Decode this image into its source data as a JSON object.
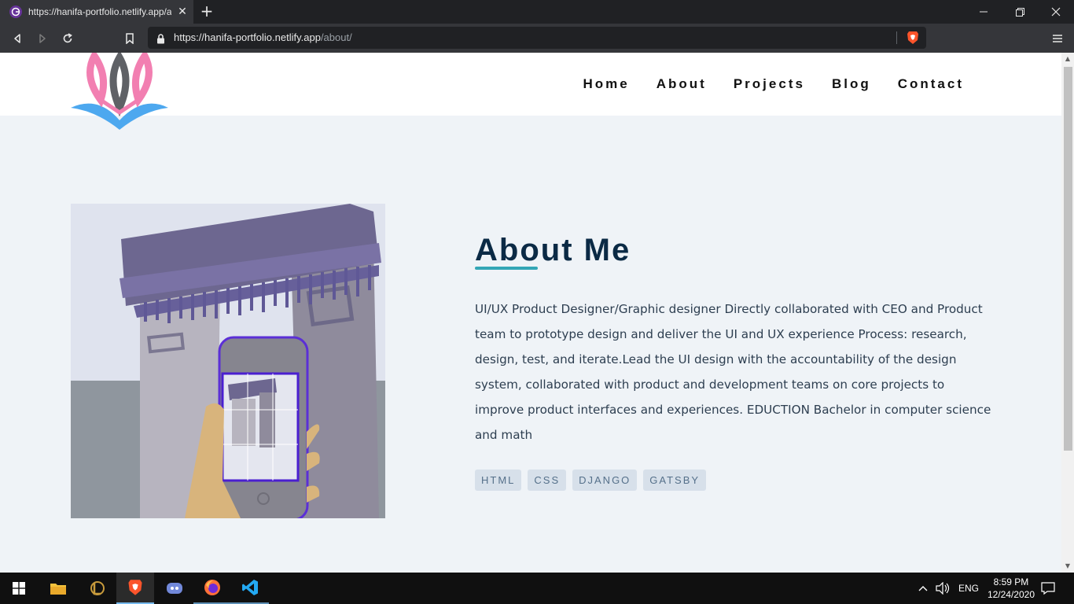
{
  "browser": {
    "tab_title": "https://hanifa-portfolio.netlify.app/about/",
    "url_host": "https://hanifa-portfolio.netlify.app",
    "url_path": "/about/"
  },
  "site": {
    "nav": [
      "Home",
      "About",
      "Projects",
      "Blog",
      "Contact"
    ],
    "about_title": "About Me",
    "about_text": "UI/UX Product Designer/Graphic designer Directly collaborated with CEO and Product team to prototype design and deliver the UI and UX experience Process: research, design, test, and iterate.Lead the UI design with the accountability of the design system, collaborated with product and development teams on core projects to improve product interfaces and experiences. EDUCTION Bachelor in computer science and math",
    "tags": [
      "HTML",
      "CSS",
      "DJANGO",
      "GATSBY"
    ],
    "accent_color": "#34a6b6",
    "heading_color": "#0b2a45"
  },
  "taskbar": {
    "apps": [
      "start-icon",
      "file-explorer-icon",
      "league-of-legends-icon",
      "brave-icon",
      "discord-icon",
      "firefox-icon",
      "vscode-icon"
    ],
    "language": "ENG",
    "time": "8:59 PM",
    "date": "12/24/2020"
  }
}
